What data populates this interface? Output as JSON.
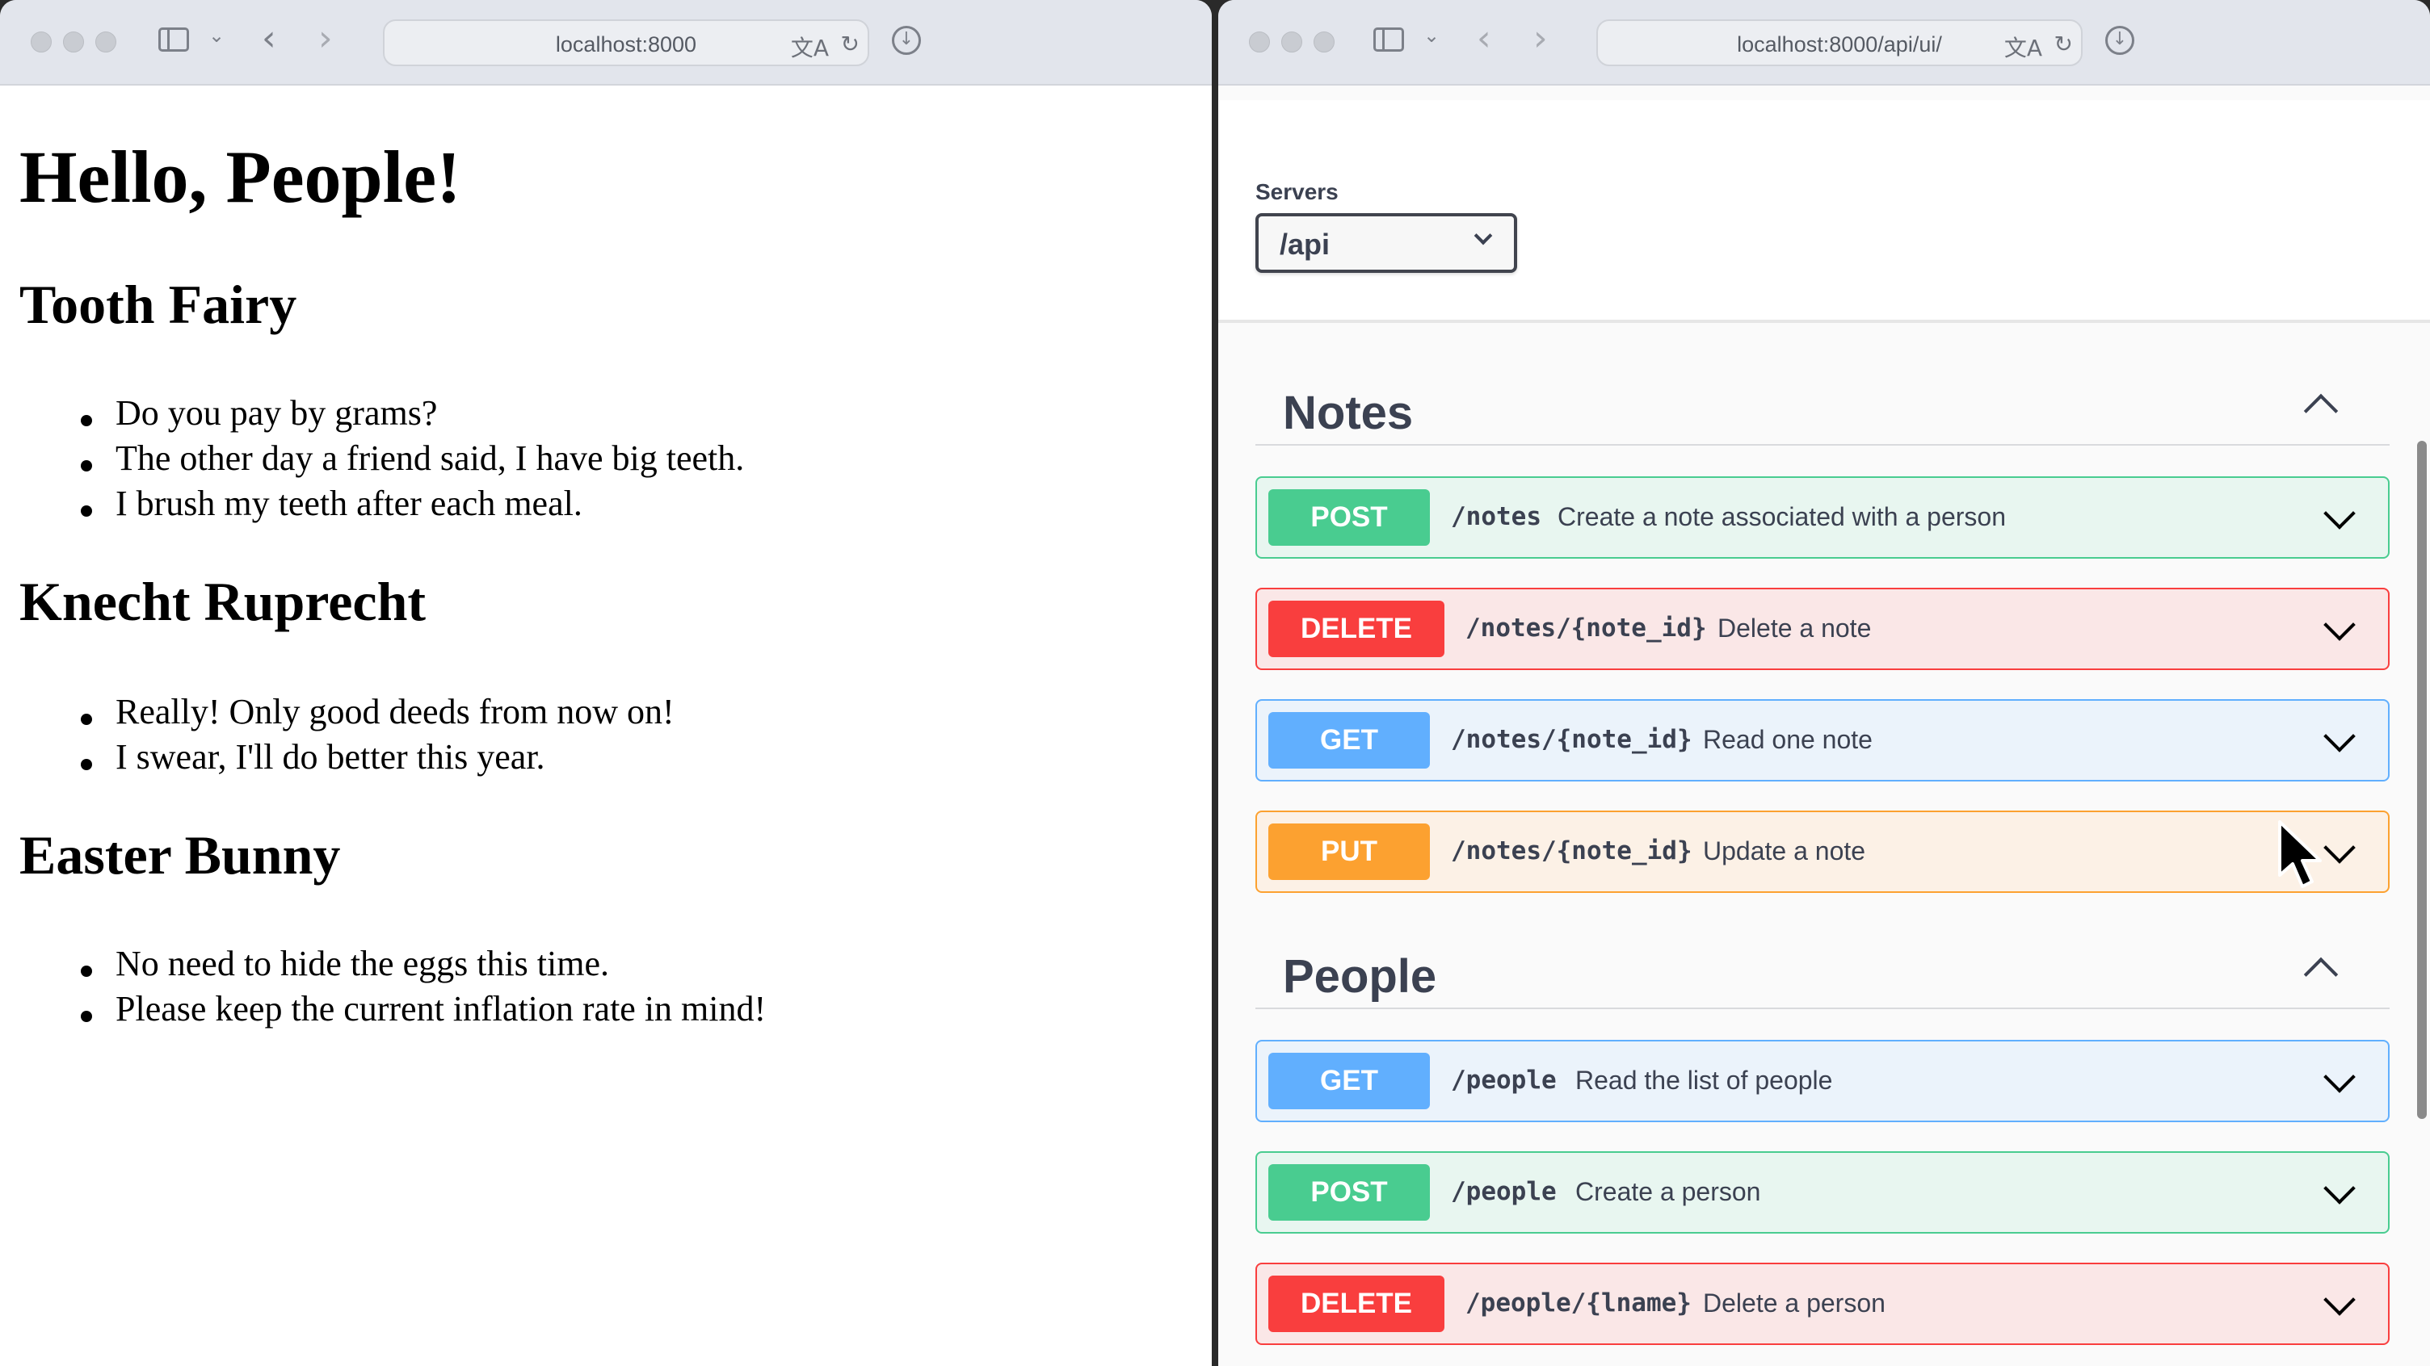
{
  "left_window": {
    "url": "localhost:8000",
    "heading": "Hello, People!",
    "people": [
      {
        "name": "Tooth Fairy",
        "notes": [
          "Do you pay by grams?",
          "The other day a friend said, I have big teeth.",
          "I brush my teeth after each meal."
        ]
      },
      {
        "name": "Knecht Ruprecht",
        "notes": [
          "Really! Only good deeds from now on!",
          "I swear, I'll do better this year."
        ]
      },
      {
        "name": "Easter Bunny",
        "notes": [
          "No need to hide the eggs this time.",
          "Please keep the current inflation rate in mind!"
        ]
      }
    ]
  },
  "right_window": {
    "url": "localhost:8000/api/ui/",
    "servers": {
      "label": "Servers",
      "value": "/api"
    },
    "tags": [
      {
        "name": "Notes",
        "operations": [
          {
            "method": "POST",
            "path": "/notes",
            "summary": "Create a note associated with a person"
          },
          {
            "method": "DELETE",
            "path": "/notes/{note_id}",
            "summary": "Delete a note"
          },
          {
            "method": "GET",
            "path": "/notes/{note_id}",
            "summary": "Read one note"
          },
          {
            "method": "PUT",
            "path": "/notes/{note_id}",
            "summary": "Update a note"
          }
        ]
      },
      {
        "name": "People",
        "operations": [
          {
            "method": "GET",
            "path": "/people",
            "summary": "Read the list of people"
          },
          {
            "method": "POST",
            "path": "/people",
            "summary": "Create a person"
          },
          {
            "method": "DELETE",
            "path": "/people/{lname}",
            "summary": "Delete a person"
          }
        ]
      }
    ]
  },
  "icons": {
    "sidebar": "sidebar-icon",
    "back": "chevron-left-icon",
    "forward": "chevron-right-icon",
    "translate": "translate-icon",
    "reload": "reload-icon",
    "download": "download-icon"
  },
  "colors": {
    "post": "#49cc90",
    "delete": "#f93e3e",
    "get": "#61affe",
    "put": "#fca130"
  }
}
